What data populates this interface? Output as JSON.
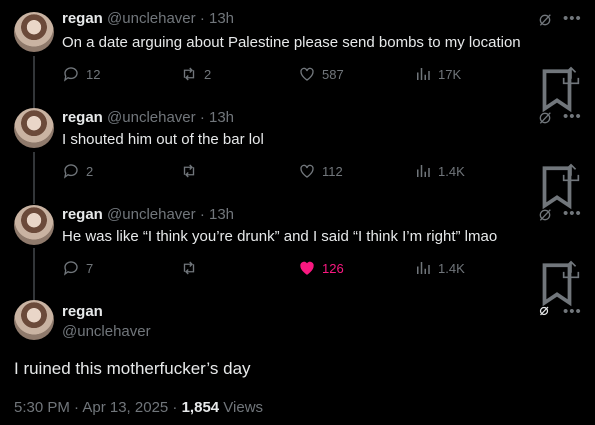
{
  "tweets": [
    {
      "name": "regan",
      "handle": "@unclehaver",
      "dot": "·",
      "time": "13h",
      "text": "On a date arguing about Palestine please send bombs to my location",
      "replies": "12",
      "retweets": "2",
      "likes": "587",
      "views": "17K",
      "liked": false
    },
    {
      "name": "regan",
      "handle": "@unclehaver",
      "dot": "·",
      "time": "13h",
      "text": "I shouted him out of the bar lol",
      "replies": "2",
      "retweets": "",
      "likes": "112",
      "views": "1.4K",
      "liked": false
    },
    {
      "name": "regan",
      "handle": "@unclehaver",
      "dot": "·",
      "time": "13h",
      "text": "He was like “I think you’re drunk” and I said “I think I’m right” lmao",
      "replies": "7",
      "retweets": "",
      "likes": "126",
      "views": "1.4K",
      "liked": true
    }
  ],
  "main": {
    "name": "regan",
    "handle": "@unclehaver",
    "text": "I ruined this motherfucker’s day",
    "time": "5:30 PM · Apr 13, 2025 · ",
    "views_count": "1,854",
    "views_label": " Views"
  },
  "colors": {
    "background": "#000000",
    "text": "#e7e9ea",
    "muted": "#71767b",
    "like_active": "#f91880"
  },
  "icons": [
    "reply-icon",
    "retweet-icon",
    "like-icon",
    "views-icon",
    "bookmark-icon",
    "share-icon",
    "grok-icon",
    "more-icon"
  ]
}
